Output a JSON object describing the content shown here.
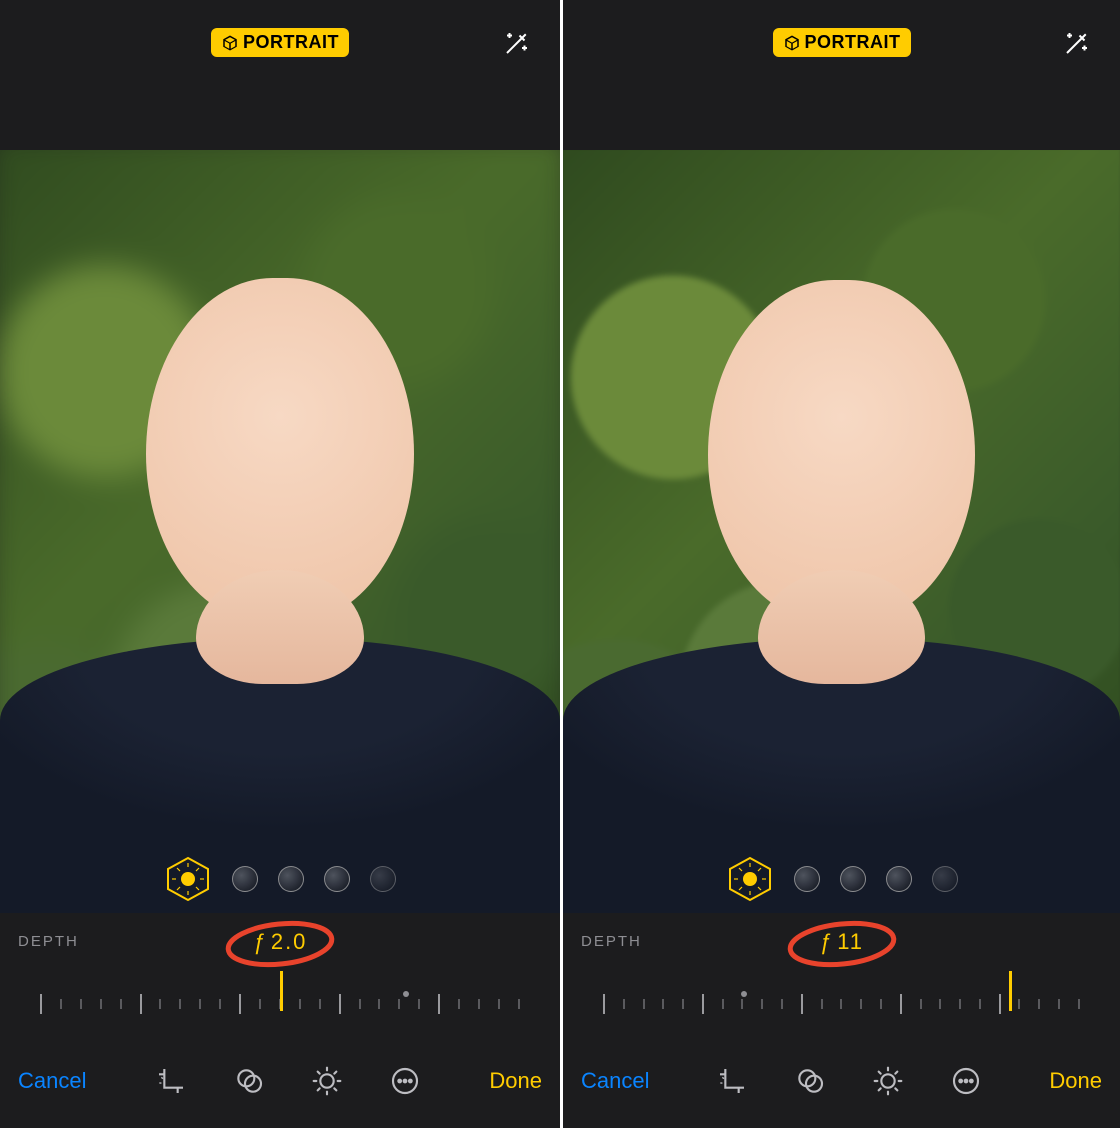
{
  "panes": [
    {
      "header": {
        "mode_label": "PORTRAIT"
      },
      "depth": {
        "label": "DEPTH",
        "fstop": "2.0",
        "indicator_pos_pct": 50,
        "origin_pos_pct": 72,
        "blur": "strong"
      },
      "toolbar": {
        "cancel": "Cancel",
        "done": "Done"
      }
    },
    {
      "header": {
        "mode_label": "PORTRAIT"
      },
      "depth": {
        "label": "DEPTH",
        "fstop": "11",
        "indicator_pos_pct": 80,
        "origin_pos_pct": 32,
        "blur": "light"
      },
      "toolbar": {
        "cancel": "Cancel",
        "done": "Done"
      }
    }
  ],
  "colors": {
    "accent": "#ffcc00",
    "link": "#0a84ff",
    "annotation": "#e8432c"
  }
}
